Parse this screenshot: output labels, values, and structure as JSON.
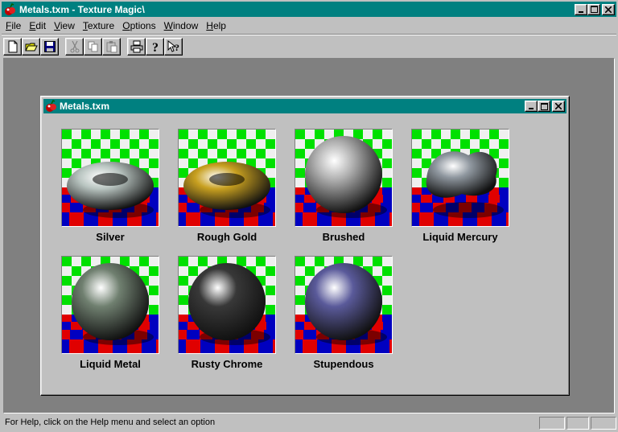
{
  "app": {
    "title": "Metals.txm - Texture Magic\\"
  },
  "menu": [
    {
      "label": "File",
      "key": "F",
      "rest": "ile"
    },
    {
      "label": "Edit",
      "key": "E",
      "rest": "dit"
    },
    {
      "label": "View",
      "key": "V",
      "rest": "iew"
    },
    {
      "label": "Texture",
      "key": "T",
      "rest": "exture"
    },
    {
      "label": "Options",
      "key": "O",
      "rest": "ptions"
    },
    {
      "label": "Window",
      "key": "W",
      "rest": "indow"
    },
    {
      "label": "Help",
      "key": "H",
      "rest": "elp"
    }
  ],
  "toolbar": [
    "new-file-icon",
    "open-folder-icon",
    "save-icon",
    "cut-icon",
    "copy-icon",
    "paste-icon",
    "print-icon",
    "help-icon",
    "context-help-icon"
  ],
  "child": {
    "title": "Metals.txm"
  },
  "textures": [
    {
      "name": "Silver",
      "shape": "torus",
      "color": "#b8c4c0"
    },
    {
      "name": "Rough Gold",
      "shape": "torus",
      "color": "#c8a020"
    },
    {
      "name": "Brushed",
      "shape": "sphere",
      "color": "#b0b0b0"
    },
    {
      "name": "Liquid Mercury",
      "shape": "blob",
      "color": "#9098a0"
    },
    {
      "name": "Liquid Metal",
      "shape": "sphere",
      "color": "#708070"
    },
    {
      "name": "Rusty Chrome",
      "shape": "sphere",
      "color": "#383838"
    },
    {
      "name": "Stupendous",
      "shape": "sphere",
      "color": "#5a5a9a"
    }
  ],
  "status": {
    "text": "For Help, click on the Help menu and select an option"
  },
  "colors": {
    "titlebar": "#008080",
    "workspace": "#808080",
    "checker_green": "#00e000",
    "checker_red": "#e00000",
    "checker_blue": "#0000c0"
  }
}
